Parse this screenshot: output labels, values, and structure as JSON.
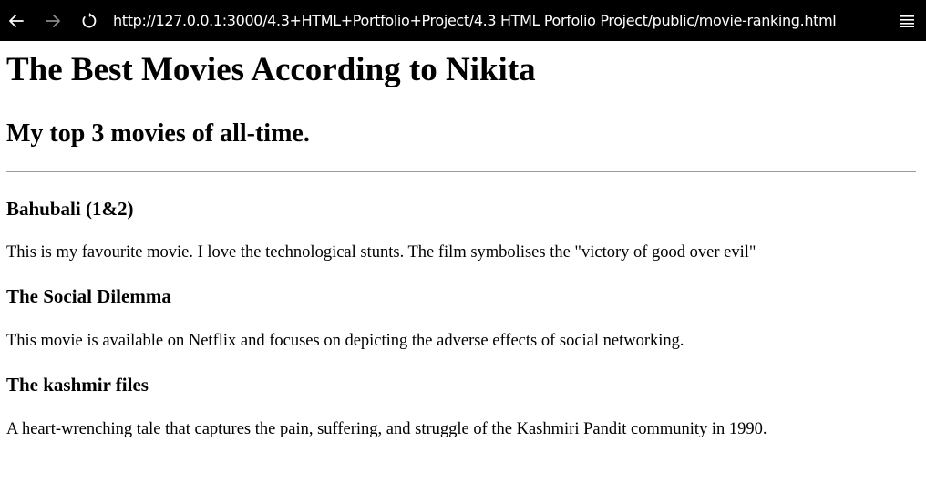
{
  "browser": {
    "url": "http://127.0.0.1:3000/4.3+HTML+Portfolio+Project/4.3 HTML Porfolio Project/public/movie-ranking.html",
    "icons": {
      "back": "arrow-left-icon",
      "forward": "arrow-right-icon",
      "reload": "reload-icon",
      "menu": "hamburger-menu-icon"
    }
  },
  "page": {
    "title": "The Best Movies According to Nikita",
    "subtitle": "My top 3 movies of all-time.",
    "movies": [
      {
        "title": "Bahubali (1&2)",
        "description": "This is my favourite movie. I love the technological stunts. The film symbolises the \"victory of good over evil\""
      },
      {
        "title": "The Social Dilemma",
        "description": "This movie is available on Netflix and focuses on depicting the adverse effects of social networking."
      },
      {
        "title": "The kashmir files",
        "description": "A heart-wrenching tale that captures the pain, suffering, and struggle of the Kashmiri Pandit community in 1990."
      }
    ]
  }
}
